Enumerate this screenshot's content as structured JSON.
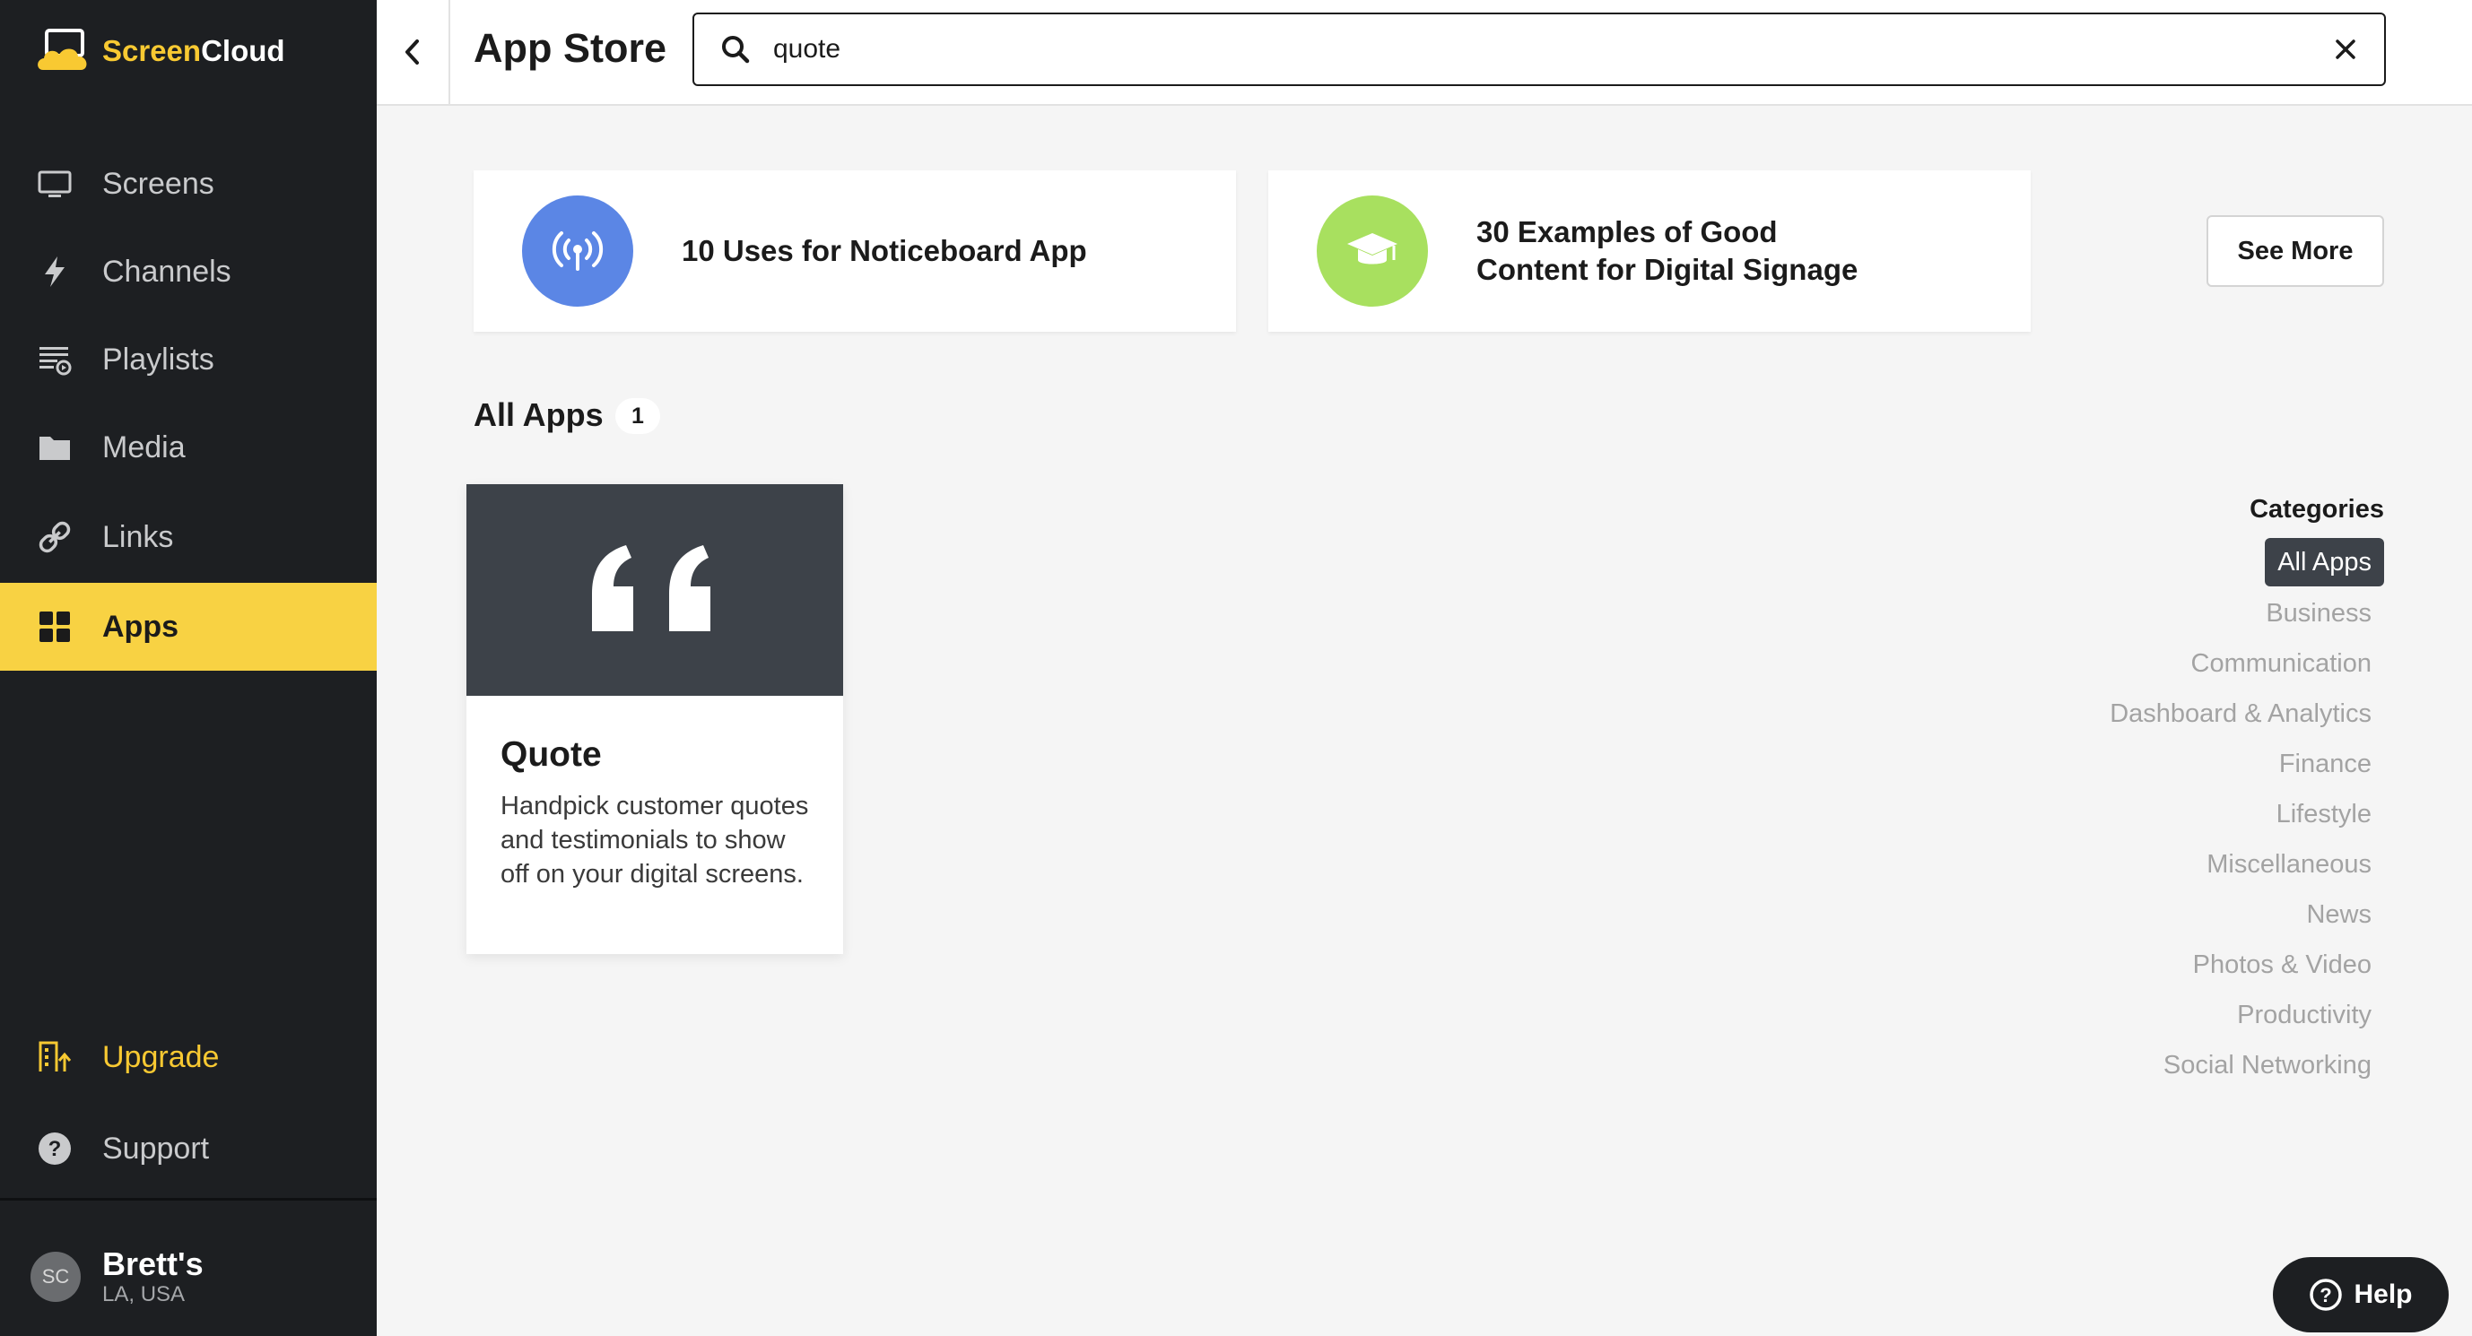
{
  "brand": {
    "name_part1": "Screen",
    "name_part2": "Cloud",
    "accent": "#f8c932"
  },
  "sidebar": {
    "items": [
      {
        "label": "Screens",
        "icon": "monitor-icon"
      },
      {
        "label": "Channels",
        "icon": "lightning-icon"
      },
      {
        "label": "Playlists",
        "icon": "playlist-icon"
      },
      {
        "label": "Media",
        "icon": "folder-icon"
      },
      {
        "label": "Links",
        "icon": "link-icon"
      },
      {
        "label": "Apps",
        "icon": "apps-grid-icon",
        "active": true
      }
    ],
    "upgrade_label": "Upgrade",
    "support_label": "Support",
    "account": {
      "initials": "SC",
      "name": "Brett's",
      "location": "LA, USA"
    }
  },
  "header": {
    "title": "App Store",
    "search": {
      "value": "quote"
    }
  },
  "featured": [
    {
      "title": "10 Uses for Noticeboard App",
      "icon": "broadcast-icon",
      "color": "#5b86e5"
    },
    {
      "title": "30 Examples of Good Content for Digital Signage",
      "icon": "graduation-cap-icon",
      "color": "#a8e05f"
    }
  ],
  "see_more_label": "See More",
  "all_apps": {
    "title": "All Apps",
    "count": "1",
    "apps": [
      {
        "name": "Quote",
        "description": "Handpick customer quotes and testimonials to show off on your digital screens.",
        "icon": "quote-marks-icon"
      }
    ]
  },
  "categories": {
    "heading": "Categories",
    "items": [
      "All Apps",
      "Business",
      "Communication",
      "Dashboard & Analytics",
      "Finance",
      "Lifestyle",
      "Miscellaneous",
      "News",
      "Photos & Video",
      "Productivity",
      "Social Networking"
    ],
    "selected": "All Apps"
  },
  "help_label": "Help"
}
